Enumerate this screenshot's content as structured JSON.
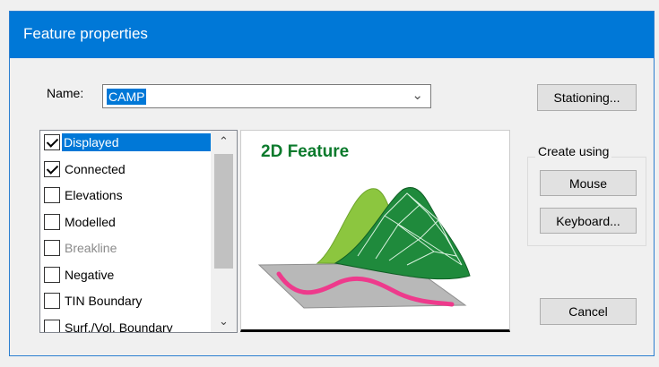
{
  "dialog": {
    "title": "Feature properties"
  },
  "name_field": {
    "label": "Name:",
    "value": "CAMP"
  },
  "buttons": {
    "stationing": "Stationing...",
    "mouse": "Mouse",
    "keyboard": "Keyboard...",
    "cancel": "Cancel"
  },
  "create_group": {
    "label": "Create using"
  },
  "options_list": {
    "items": [
      {
        "label": "Displayed",
        "checked": true,
        "selected": true,
        "enabled": true
      },
      {
        "label": "Connected",
        "checked": true,
        "selected": false,
        "enabled": true
      },
      {
        "label": "Elevations",
        "checked": false,
        "selected": false,
        "enabled": true
      },
      {
        "label": "Modelled",
        "checked": false,
        "selected": false,
        "enabled": true
      },
      {
        "label": "Breakline",
        "checked": false,
        "selected": false,
        "enabled": false
      },
      {
        "label": "Negative",
        "checked": false,
        "selected": false,
        "enabled": true
      },
      {
        "label": "TIN Boundary",
        "checked": false,
        "selected": false,
        "enabled": true
      },
      {
        "label": "Surf./Vol. Boundary",
        "checked": false,
        "selected": false,
        "enabled": true
      }
    ]
  },
  "preview": {
    "title": "2D Feature"
  },
  "colors": {
    "accent": "#0078d7",
    "preview_title": "#0b7a2c",
    "feature_line": "#ee3a8c"
  }
}
